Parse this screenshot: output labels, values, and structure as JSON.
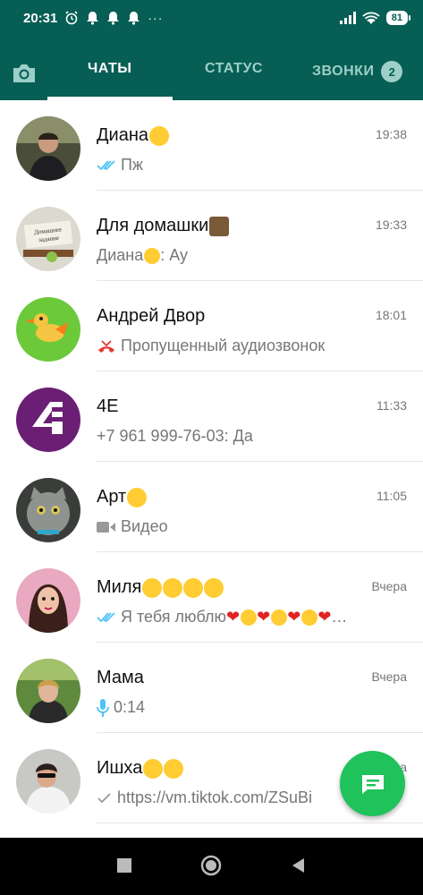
{
  "status": {
    "time": "20:31",
    "dots": "···",
    "battery": "81"
  },
  "tabs": {
    "chats": "ЧАТЫ",
    "status": "СТАТУС",
    "calls": "ЗВОНКИ",
    "calls_badge": "2"
  },
  "chats": [
    {
      "name": "Диана",
      "name_emoji": [
        "kiss"
      ],
      "time": "19:38",
      "msg": "Пж",
      "msg_prefix": "double-check-icon"
    },
    {
      "name": "Для домашки",
      "name_emoji": [
        "books"
      ],
      "time": "19:33",
      "msg": "Ау",
      "sender": "Диана"
    },
    {
      "name": "Андрей Двор",
      "time": "18:01",
      "msg": "Пропущенный аудиозвонок",
      "msg_prefix": "missed-call-icon"
    },
    {
      "name": "4E",
      "time": "11:33",
      "msg": "+7 961 999-76-03: Да"
    },
    {
      "name": "Арт",
      "name_emoji": [
        "smile"
      ],
      "time": "11:05",
      "msg": "Видео",
      "msg_prefix": "video-icon"
    },
    {
      "name": "Миля",
      "name_emoji": [
        "hearteyes",
        "hearteyes",
        "kiss",
        "kiss"
      ],
      "time": "Вчера",
      "msg": "Я тебя люблю",
      "msg_prefix": "double-check-icon"
    },
    {
      "name": "Мама",
      "time": "Вчера",
      "msg": "0:14",
      "msg_prefix": "mic-icon"
    },
    {
      "name": "Ишха",
      "name_emoji": [
        "cowboy",
        "sunglasses"
      ],
      "time": "Вчера",
      "msg": "https://vm.tiktok.com/ZSuBi",
      "msg_prefix": "single-check-icon"
    }
  ],
  "colors": {
    "header": "#075e54",
    "accent": "#1fc25b",
    "tick_blue": "#4fc3f7"
  }
}
